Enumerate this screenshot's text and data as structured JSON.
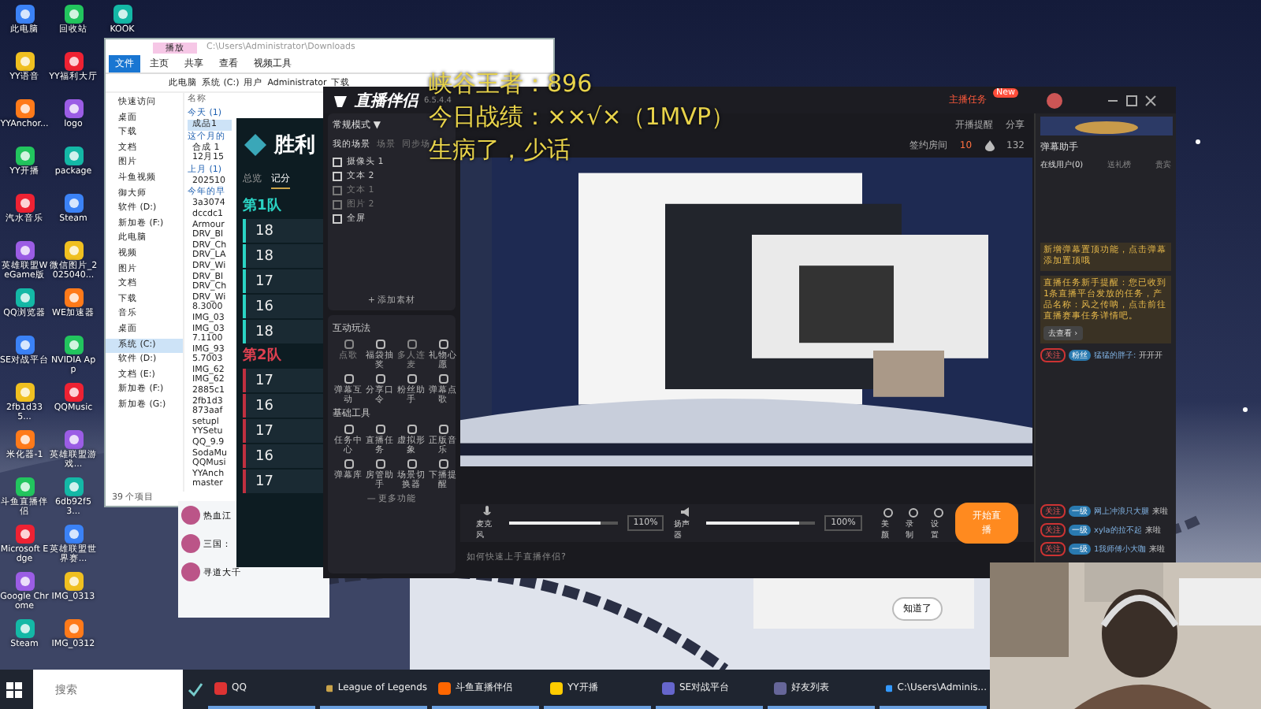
{
  "desktop_icons": {
    "columns": [
      [
        "此电脑",
        "YY语音",
        "YYAnchor...",
        "YY开播",
        "汽水音乐",
        "英雄联盟WeGame版",
        "QQ浏览器",
        "SE对战平台",
        "2fb1d335...",
        "米化器-1",
        "斗鱼直播伴侣",
        "Microsoft Edge",
        "Google Chrome",
        "Steam"
      ],
      [
        "回收站",
        "YY福利大厅",
        "logo",
        "package",
        "Steam",
        "微信图片_2025040...",
        "WE加速器",
        "NVIDIA App",
        "QQMusic",
        "英雄联盟游戏...",
        "6db92f53...",
        "英雄联盟世界赛...",
        "IMG_0313",
        "IMG_0312"
      ],
      [
        "KOOK"
      ]
    ]
  },
  "explorer": {
    "title": "C:\\Users\\Administrator\\Downloads",
    "context_tab": "播放",
    "ribbon_tabs": [
      {
        "label": "文件",
        "selected": true
      },
      {
        "label": "主页",
        "selected": false
      },
      {
        "label": "共享",
        "selected": false
      },
      {
        "label": "查看",
        "selected": false
      },
      {
        "label": "视频工具",
        "selected": false
      }
    ],
    "path": [
      "此电脑",
      "系统 (C:)",
      "用户",
      "Administrator",
      "下载"
    ],
    "sidebar": [
      {
        "label": "快速访问",
        "selected": false
      },
      {
        "label": "桌面",
        "selected": false
      },
      {
        "label": "下载",
        "selected": false
      },
      {
        "label": "文档",
        "selected": false
      },
      {
        "label": "图片",
        "selected": false
      },
      {
        "label": "斗鱼视频",
        "selected": false
      },
      {
        "label": "御大师",
        "selected": false
      },
      {
        "label": "软件 (D:)",
        "selected": false
      },
      {
        "label": "新加卷 (F:)",
        "selected": false
      },
      {
        "label": "此电脑",
        "selected": false
      },
      {
        "label": "视频",
        "selected": false
      },
      {
        "label": "图片",
        "selected": false
      },
      {
        "label": "文档",
        "selected": false
      },
      {
        "label": "下载",
        "selected": false
      },
      {
        "label": "音乐",
        "selected": false
      },
      {
        "label": "桌面",
        "selected": false
      },
      {
        "label": "系统 (C:)",
        "selected": true
      },
      {
        "label": "软件 (D:)",
        "selected": false
      },
      {
        "label": "文档 (E:)",
        "selected": false
      },
      {
        "label": "新加卷 (F:)",
        "selected": false
      },
      {
        "label": "新加卷 (G:)",
        "selected": false
      }
    ],
    "column_header": "名称",
    "groups": [
      {
        "title": "今天 (1)",
        "files": [
          {
            "name": "成品1",
            "selected": true
          }
        ]
      },
      {
        "title": "这个月的",
        "files": [
          {
            "name": "合成 1",
            "selected": false
          },
          {
            "name": "12月15",
            "selected": false
          }
        ]
      },
      {
        "title": "上月 (1)",
        "files": [
          {
            "name": "202510",
            "selected": false
          }
        ]
      },
      {
        "title": "今年的早",
        "files": [
          {
            "name": "3a3074",
            "selected": false
          },
          {
            "name": "dccdc1",
            "selected": false
          },
          {
            "name": "Armour",
            "selected": false
          },
          {
            "name": "DRV_Bl",
            "selected": false
          },
          {
            "name": "DRV_Ch",
            "selected": false
          },
          {
            "name": "DRV_LA",
            "selected": false
          },
          {
            "name": "DRV_Wi",
            "selected": false
          },
          {
            "name": "DRV_Bl",
            "selected": false
          },
          {
            "name": "DRV_Ch",
            "selected": false
          },
          {
            "name": "DRV_Wi",
            "selected": false
          },
          {
            "name": "8.3000",
            "selected": false
          },
          {
            "name": "IMG_03",
            "selected": false
          },
          {
            "name": "IMG_03",
            "selected": false
          },
          {
            "name": "7.1100",
            "selected": false
          },
          {
            "name": "IMG_93",
            "selected": false
          },
          {
            "name": "5.7003",
            "selected": false
          },
          {
            "name": "IMG_62",
            "selected": false
          },
          {
            "name": "IMG_62",
            "selected": false
          },
          {
            "name": "2885c1",
            "selected": false
          },
          {
            "name": "2fb1d3",
            "selected": false
          },
          {
            "name": "873aaf",
            "selected": false
          },
          {
            "name": "setupl",
            "selected": false
          },
          {
            "name": "YYSetu",
            "selected": false
          },
          {
            "name": "QQ_9.9",
            "selected": false
          },
          {
            "name": "SodaMu",
            "selected": false
          },
          {
            "name": "QQMusi",
            "selected": false
          },
          {
            "name": "YYAnch",
            "selected": false
          },
          {
            "name": "master",
            "selected": false
          }
        ]
      }
    ],
    "status": "39 个项目"
  },
  "qq_list": [
    "热血江",
    "三国：",
    "寻道大千"
  ],
  "game": {
    "title": "胜利",
    "tabs": [
      {
        "label": "总览",
        "selected": false
      },
      {
        "label": "记分",
        "selected": true
      }
    ],
    "teams": [
      {
        "name": "第1队",
        "levels": [
          "18",
          "18",
          "17",
          "16",
          "18"
        ]
      },
      {
        "name": "第2队",
        "levels": [
          "17",
          "16",
          "17",
          "16",
          "17"
        ]
      }
    ]
  },
  "stream_app": {
    "logo": "直播伴侣",
    "version": "6.5.4.4",
    "task_button": "主播任务",
    "task_badge": "New",
    "links": [
      "开播提醒",
      "分享"
    ],
    "room_label": "签约房间",
    "room_count": "10",
    "likes": "132",
    "mode": "常规模式 ▼",
    "scene_tabs": [
      {
        "label": "我的场景",
        "selected": true
      },
      {
        "label": "场景",
        "selected": false
      },
      {
        "label": "同步场",
        "selected": false
      }
    ],
    "sources": [
      {
        "label": "摄像头 1",
        "visible": true
      },
      {
        "label": "文本 2",
        "visible": true
      },
      {
        "label": "文本 1",
        "visible": false
      },
      {
        "label": "图片 2",
        "visible": false
      },
      {
        "label": "全屏",
        "visible": true
      }
    ],
    "add_source": "+ 添加素材",
    "tool_sections": [
      {
        "title": "互动玩法",
        "tools": [
          {
            "label": "点歌",
            "disabled": true
          },
          {
            "label": "福袋抽奖",
            "disabled": false
          },
          {
            "label": "多人连麦",
            "disabled": true
          },
          {
            "label": "礼物心愿",
            "disabled": false
          },
          {
            "label": "弹幕互动",
            "disabled": false
          },
          {
            "label": "分享口令",
            "disabled": false
          },
          {
            "label": "粉丝助手",
            "disabled": false
          },
          {
            "label": "弹幕点歌",
            "disabled": false
          }
        ]
      },
      {
        "title": "基础工具",
        "tools": [
          {
            "label": "任务中心",
            "disabled": false
          },
          {
            "label": "直播任务",
            "disabled": false
          },
          {
            "label": "虚拟形象",
            "disabled": false
          },
          {
            "label": "正版音乐",
            "disabled": false
          },
          {
            "label": "弹幕库",
            "disabled": false
          },
          {
            "label": "房管助手",
            "disabled": false
          },
          {
            "label": "场景切换器",
            "disabled": false
          },
          {
            "label": "下播提醒",
            "disabled": false
          }
        ]
      }
    ],
    "more": "— 更多功能",
    "audio": [
      {
        "label": "麦克风",
        "level": 0.85,
        "reading": "110%"
      },
      {
        "label": "扬声器",
        "level": 0.85,
        "reading": "100%"
      }
    ],
    "help": "如何快速上手直播伴侣?",
    "actions": [
      "美颜",
      "录制",
      "设置"
    ],
    "start_button": "开始直播"
  },
  "overlay": [
    "峡谷王者：896",
    "今日战绩：××√×（1MVP）",
    "生病了，少话"
  ],
  "chat": {
    "title": "弹幕助手",
    "tabs": [
      {
        "label": "在线用户(0)",
        "selected": true
      },
      {
        "label": "送礼榜",
        "selected": false
      },
      {
        "label": "贵宾",
        "selected": false
      }
    ],
    "notices": [
      "新增弹幕置顶功能，点击弹幕添加置顶哦",
      "直播任务新手提醒：您已收到1条直播平台发放的任务，产品名称：风之传呐，点击前往直播赛事任务详情吧。"
    ],
    "notice_button": "去查看 ›",
    "messages": [
      {
        "tag": "关注",
        "level": "粉丝",
        "user": "猛猛的胖子:",
        "text": "开开开"
      },
      {
        "tag": "关注",
        "level": "一级",
        "user": "网上冲浪只大腿",
        "text": "来啦"
      },
      {
        "tag": "关注",
        "level": "一级",
        "user": "xyla的拉不起",
        "text": "来啦"
      },
      {
        "tag": "关注",
        "level": "一级",
        "user": "1我师傅小大咖",
        "text": "来啦"
      }
    ]
  },
  "popup": {
    "button": "知道了"
  },
  "taskbar": {
    "search": {
      "placeholder": "搜索"
    },
    "apps": [
      "QQ",
      "League of Legends",
      "斗鱼直播伴侣",
      "YY开播",
      "SE对战平台",
      "好友列表",
      "C:\\Users\\Adminis..."
    ]
  }
}
